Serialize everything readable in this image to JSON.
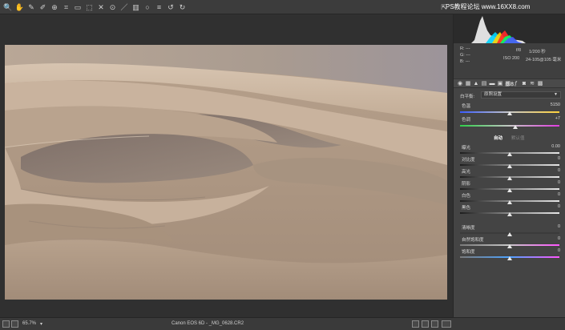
{
  "toolbar": {
    "tools": [
      {
        "icon": "zoom-icon",
        "glyph": "🔍"
      },
      {
        "icon": "hand-icon",
        "glyph": "✋"
      },
      {
        "icon": "white-balance-icon",
        "glyph": "✎"
      },
      {
        "icon": "color-sampler-icon",
        "glyph": "✐"
      },
      {
        "icon": "target-adjust-icon",
        "glyph": "⊕"
      },
      {
        "icon": "crop-icon",
        "glyph": "⌗"
      },
      {
        "icon": "straighten-icon",
        "glyph": "▭"
      },
      {
        "icon": "transform-icon",
        "glyph": "⬚"
      },
      {
        "icon": "spot-removal-icon",
        "glyph": "✕"
      },
      {
        "icon": "red-eye-icon",
        "glyph": "⊙"
      },
      {
        "icon": "adjustment-brush-icon",
        "glyph": "／"
      },
      {
        "icon": "graduated-filter-icon",
        "glyph": "▥"
      },
      {
        "icon": "radial-filter-icon",
        "glyph": "○"
      },
      {
        "icon": "presets-icon",
        "glyph": "≡"
      },
      {
        "icon": "rotate-left-icon",
        "glyph": "↺"
      },
      {
        "icon": "rotate-right-icon",
        "glyph": "↻"
      }
    ],
    "preview_toggle_icon": "fullscreen-icon",
    "watermark": "PS教程论坛 www.16XX8.com"
  },
  "status": {
    "zoom": "65.7%",
    "filename": "Canon EOS 6D  -  _MG_0628.CR2"
  },
  "histogram": {
    "colors": [
      "#ffffff",
      "#00d4ff",
      "#ffd200",
      "#ff2a2a",
      "#00ff66",
      "#4a5aff"
    ]
  },
  "metadata": {
    "r": "R:   ---",
    "g": "G:   ---",
    "b": "B:   ---",
    "aperture": "f/8",
    "shutter": "1/200 秒",
    "iso": "ISO 200",
    "lens": "24-105@105 毫米"
  },
  "panel": {
    "section_basic": "基本",
    "wb_label": "白平衡:",
    "wb_value": "原照设置",
    "temp_label": "色温",
    "temp_value": "5150",
    "temp_level": 0.5,
    "tint_label": "色调",
    "tint_value": "+7",
    "tint_level": 0.56,
    "auto_label": "自动",
    "default_label": "默认值",
    "sliders": [
      {
        "label": "曝光",
        "value": "0.00",
        "level": 0.5
      },
      {
        "label": "对比度",
        "value": "0",
        "level": 0.5
      },
      {
        "label": "高光",
        "value": "0",
        "level": 0.5
      },
      {
        "label": "阴影",
        "value": "0",
        "level": 0.5
      },
      {
        "label": "白色",
        "value": "0",
        "level": 0.5
      },
      {
        "label": "黑色",
        "value": "0",
        "level": 0.5
      },
      {
        "label": "清晰度",
        "value": "0",
        "level": 0.5
      },
      {
        "label": "自然饱和度",
        "value": "0",
        "level": 0.5
      },
      {
        "label": "饱和度",
        "value": "0",
        "level": 0.5
      }
    ]
  }
}
